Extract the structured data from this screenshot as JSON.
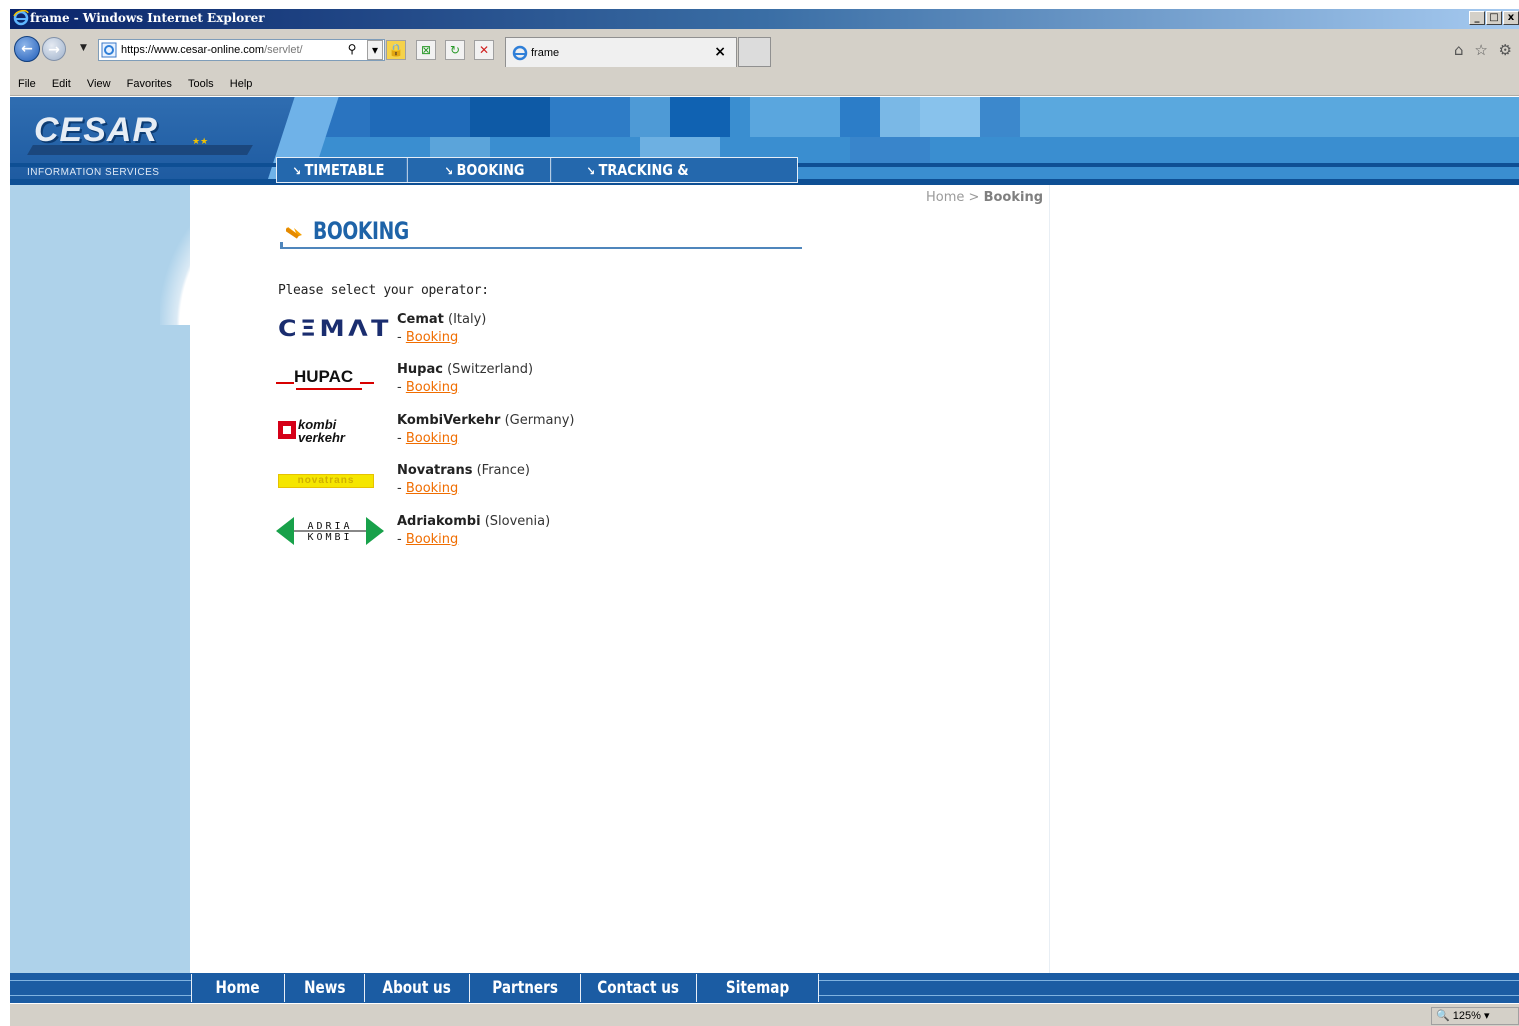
{
  "window": {
    "title": "frame - Windows Internet Explorer",
    "controls": [
      "_",
      "□",
      "x"
    ]
  },
  "toolbar": {
    "url_prefix": "https://",
    "url_domain": "www.cesar-online.com",
    "url_path": "/servlet/",
    "tab_label": "frame",
    "tab_close": "×",
    "right_icons": "⌂ ☆ ⚙"
  },
  "menu": [
    "File",
    "Edit",
    "View",
    "Favorites",
    "Tools",
    "Help"
  ],
  "header": {
    "logo_text": "CESAR",
    "tagline": "INFORMATION SERVICES",
    "nav": [
      "TIMETABLE",
      "BOOKING",
      "TRACKING & TRACING"
    ]
  },
  "breadcrumb": {
    "home": "Home",
    "separator": ">",
    "current": "Booking"
  },
  "page": {
    "title": "BOOKING",
    "prompt": "Please select your operator:"
  },
  "operators": [
    {
      "name": "Cemat",
      "country": "(Italy)",
      "link": "Booking",
      "logo": "CΞMΛT"
    },
    {
      "name": "Hupac",
      "country": "(Switzerland)",
      "link": "Booking",
      "logo": "HUPAC"
    },
    {
      "name": "KombiVerkehr",
      "country": "(Germany)",
      "link": "Booking",
      "logo_line1": "kombi",
      "logo_line2": "verkehr"
    },
    {
      "name": "Novatrans",
      "country": "(France)",
      "link": "Booking",
      "logo": "novatrans"
    },
    {
      "name": "Adriakombi",
      "country": "(Slovenia)",
      "link": "Booking",
      "logo_line1": "ADRIA",
      "logo_line2": "KOMBI"
    }
  ],
  "footer": [
    "Home",
    "News",
    "About us",
    "Partners",
    "Contact us",
    "Sitemap"
  ],
  "status": {
    "zoom": "125%"
  },
  "colors": {
    "accent": "#f06d00",
    "title": "#1e63a8",
    "nav": "#2468ad"
  }
}
